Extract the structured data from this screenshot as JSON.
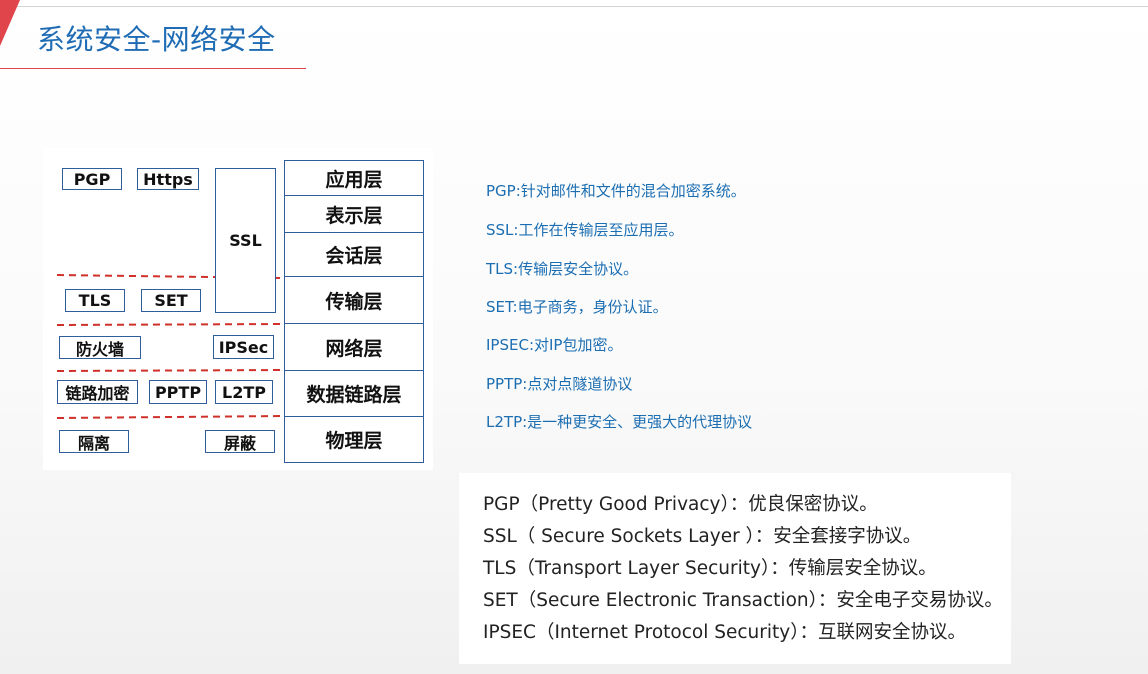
{
  "title": "系统安全-网络安全",
  "diagram": {
    "layers": [
      "应用层",
      "表示层",
      "会话层",
      "传输层",
      "网络层",
      "数据链路层",
      "物理层"
    ],
    "protocols": {
      "pgp": "PGP",
      "https": "Https",
      "ssl": "SSL",
      "tls": "TLS",
      "set": "SET",
      "firewall": "防火墙",
      "ipsec": "IPSec",
      "link_encrypt": "链路加密",
      "pptp": "PPTP",
      "l2tp": "L2TP",
      "isolation": "隔离",
      "shield": "屏蔽"
    }
  },
  "notes": [
    "PGP:针对邮件和文件的混合加密系统。",
    "SSL:工作在传输层至应用层。",
    "TLS:传输层安全协议。",
    "SET:电子商务，身份认证。",
    "IPSEC:对IP包加密。",
    "PPTP:点对点隧道协议",
    "L2TP:是一种更安全、更强大的代理协议"
  ],
  "definitions": [
    "PGP（Pretty Good Privacy）：优良保密协议。",
    "SSL（ Secure Sockets Layer ）：安全套接字协议。",
    "TLS（Transport Layer Security）：传输层安全协议。",
    "SET（Secure Electronic Transaction）：安全电子交易协议。",
    "IPSEC（Internet Protocol Security）：互联网安全协议。"
  ],
  "colors": {
    "accent_red": "#e0454c",
    "title_blue": "#1f6cb4",
    "note_blue": "#1c6eb2",
    "box_border": "#2f5e9a"
  }
}
